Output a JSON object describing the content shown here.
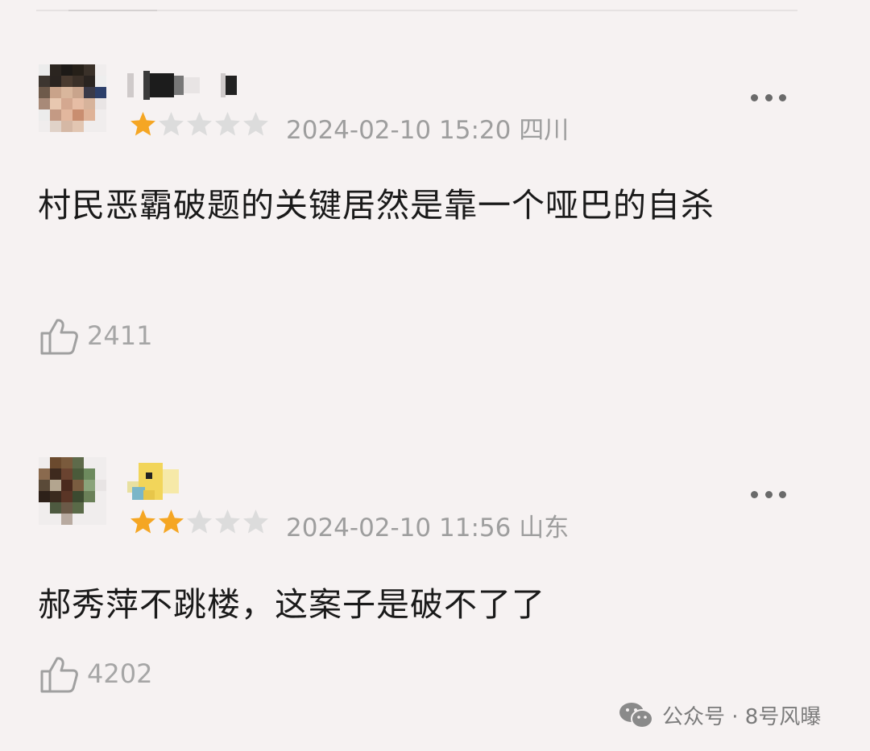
{
  "comments": [
    {
      "username": "",
      "rating": 1,
      "max_rating": 5,
      "timestamp": "2024-02-10 15:20",
      "location": "四川",
      "meta_text": "2024-02-10 15:20 四川",
      "text": "村民恶霸破题的关键居然是靠一个哑巴的自杀",
      "likes": "2411",
      "avatar_icon": "pixelated-avatar",
      "more_icon": "more-options-icon",
      "like_icon": "thumbs-up-icon"
    },
    {
      "username": "",
      "rating": 2,
      "max_rating": 5,
      "timestamp": "2024-02-10 11:56",
      "location": "山东",
      "meta_text": "2024-02-10 11:56 山东",
      "text": "郝秀萍不跳楼，这案子是破不了了",
      "likes": "4202",
      "avatar_icon": "pixelated-avatar",
      "more_icon": "more-options-icon",
      "like_icon": "thumbs-up-icon"
    }
  ],
  "watermark": {
    "icon": "wechat-icon",
    "text": "公众号 · 8号风曝"
  },
  "colors": {
    "background": "#f6f2f2",
    "star_active": "#f5a623",
    "star_inactive": "#dcdcdc",
    "meta_text": "#9e9e9e",
    "like_text": "#a6a6a6",
    "body_text": "#1a1a1a"
  }
}
